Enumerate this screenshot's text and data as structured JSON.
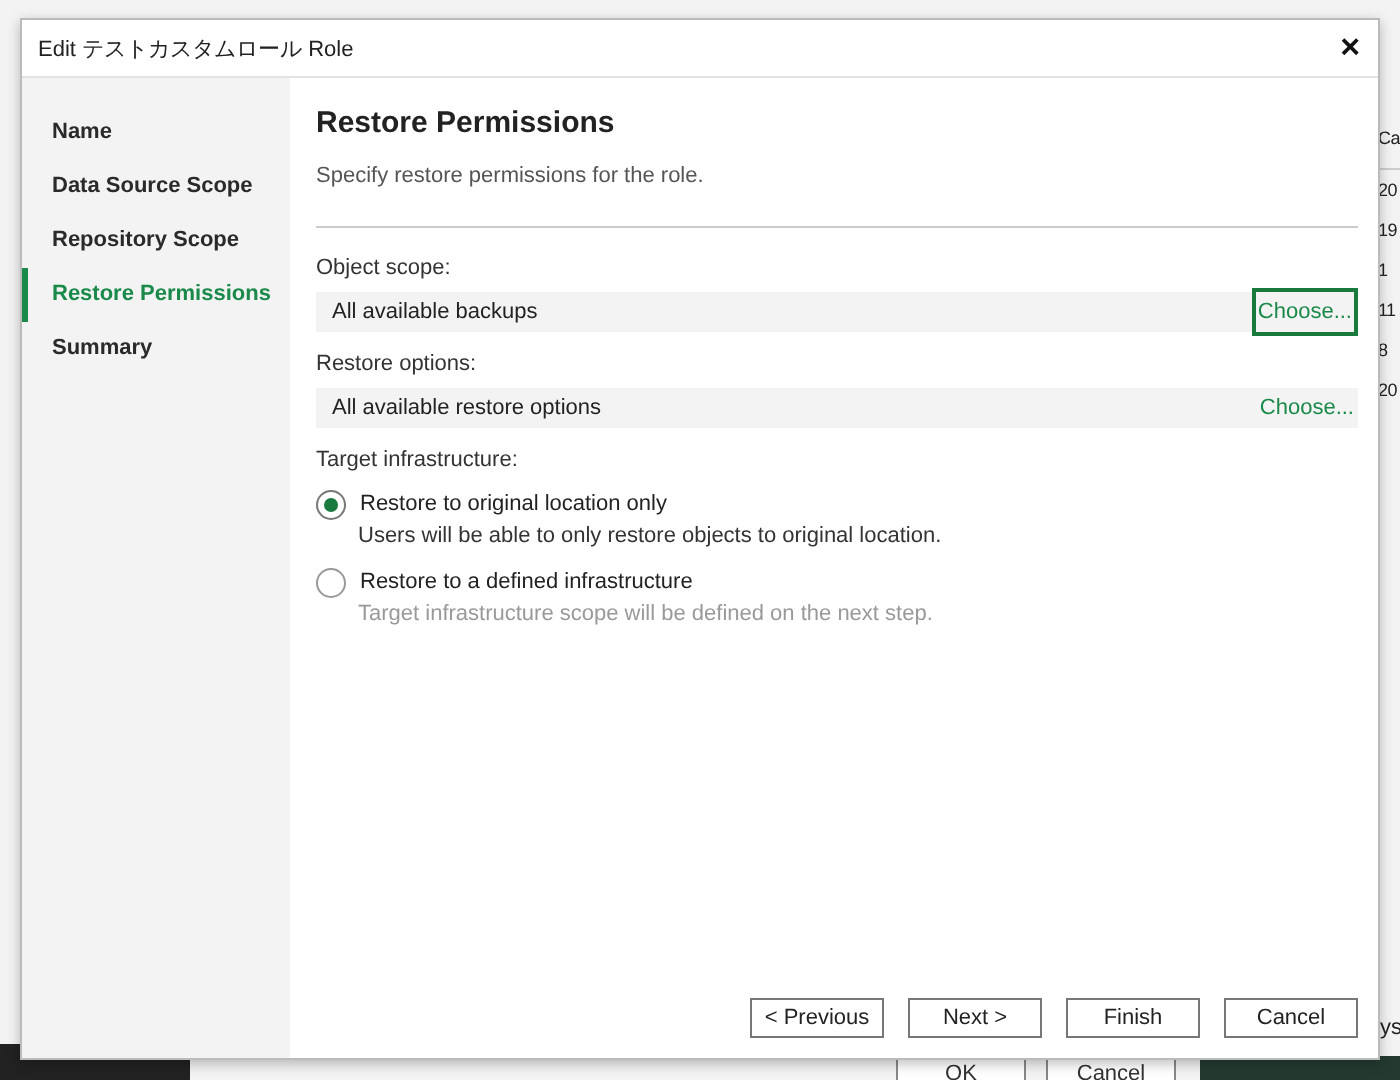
{
  "background": {
    "column_header": "Ca",
    "cells": [
      "20",
      "19",
      "1",
      "11",
      "8",
      "20"
    ],
    "side_text": "ys",
    "buttons": [
      "OK",
      "Cancel"
    ]
  },
  "window": {
    "title": "Edit テストカスタムロール Role",
    "close": "×"
  },
  "sidebar": {
    "items": [
      {
        "label": "Name",
        "selected": false
      },
      {
        "label": "Data Source Scope",
        "selected": false
      },
      {
        "label": "Repository Scope",
        "selected": false
      },
      {
        "label": "Restore Permissions",
        "selected": true
      },
      {
        "label": "Summary",
        "selected": false
      }
    ]
  },
  "page": {
    "title": "Restore Permissions",
    "subtitle": "Specify restore permissions for the role."
  },
  "scopes": [
    {
      "label": "Object scope:",
      "value": "All available backups",
      "link": "Choose...",
      "focused": true
    },
    {
      "label": "Restore options:",
      "value": "All available restore options",
      "link": "Choose...",
      "focused": false
    }
  ],
  "target": {
    "label": "Target infrastructure:",
    "options": [
      {
        "label": "Restore to original location only",
        "description": "Users will be able to only restore objects to original location.",
        "selected": true
      },
      {
        "label": "Restore to a defined infrastructure",
        "description": "Target infrastructure scope will be defined on the next step.",
        "selected": false
      }
    ]
  },
  "buttons": [
    "< Previous",
    "Next >",
    "Finish",
    "Cancel"
  ]
}
